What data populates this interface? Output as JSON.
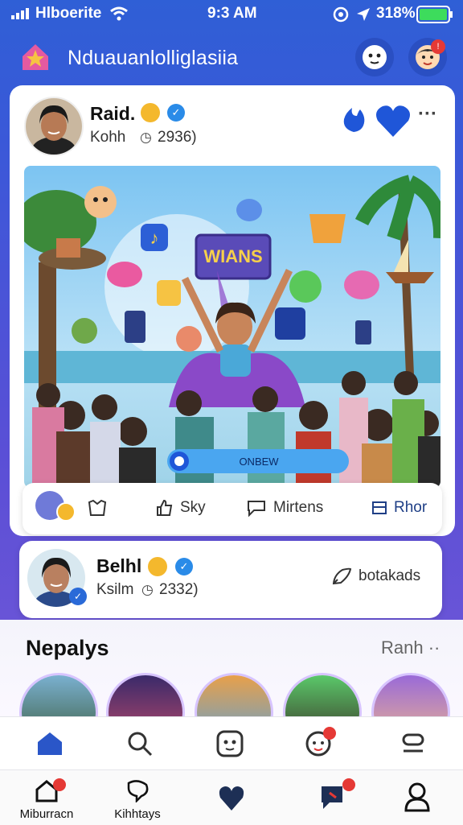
{
  "status_bar": {
    "carrier": "Hlboerite",
    "time": "9:3 AM",
    "battery": "318%"
  },
  "header": {
    "title": "Nduauanlolliglasiia"
  },
  "post": {
    "author": "Raid.",
    "subtitle": "Kohh",
    "count": "2936)",
    "image_sign": "WIANS",
    "image_button": "ONBEW"
  },
  "actions": {
    "like": "Sky",
    "comment": "Mirtens",
    "share": "Rhor"
  },
  "post2": {
    "author": "Belhl",
    "subtitle": "Ksilm",
    "count": "2332)",
    "action": "botakads"
  },
  "section": {
    "title": "Nepalys",
    "link": "Ranh"
  },
  "bottom_nav": {
    "home": "Miburracn",
    "explore": "Kihhtays"
  },
  "colors": {
    "primary": "#2f5fd6",
    "accent": "#f4b82d",
    "badge": "#e53935"
  }
}
